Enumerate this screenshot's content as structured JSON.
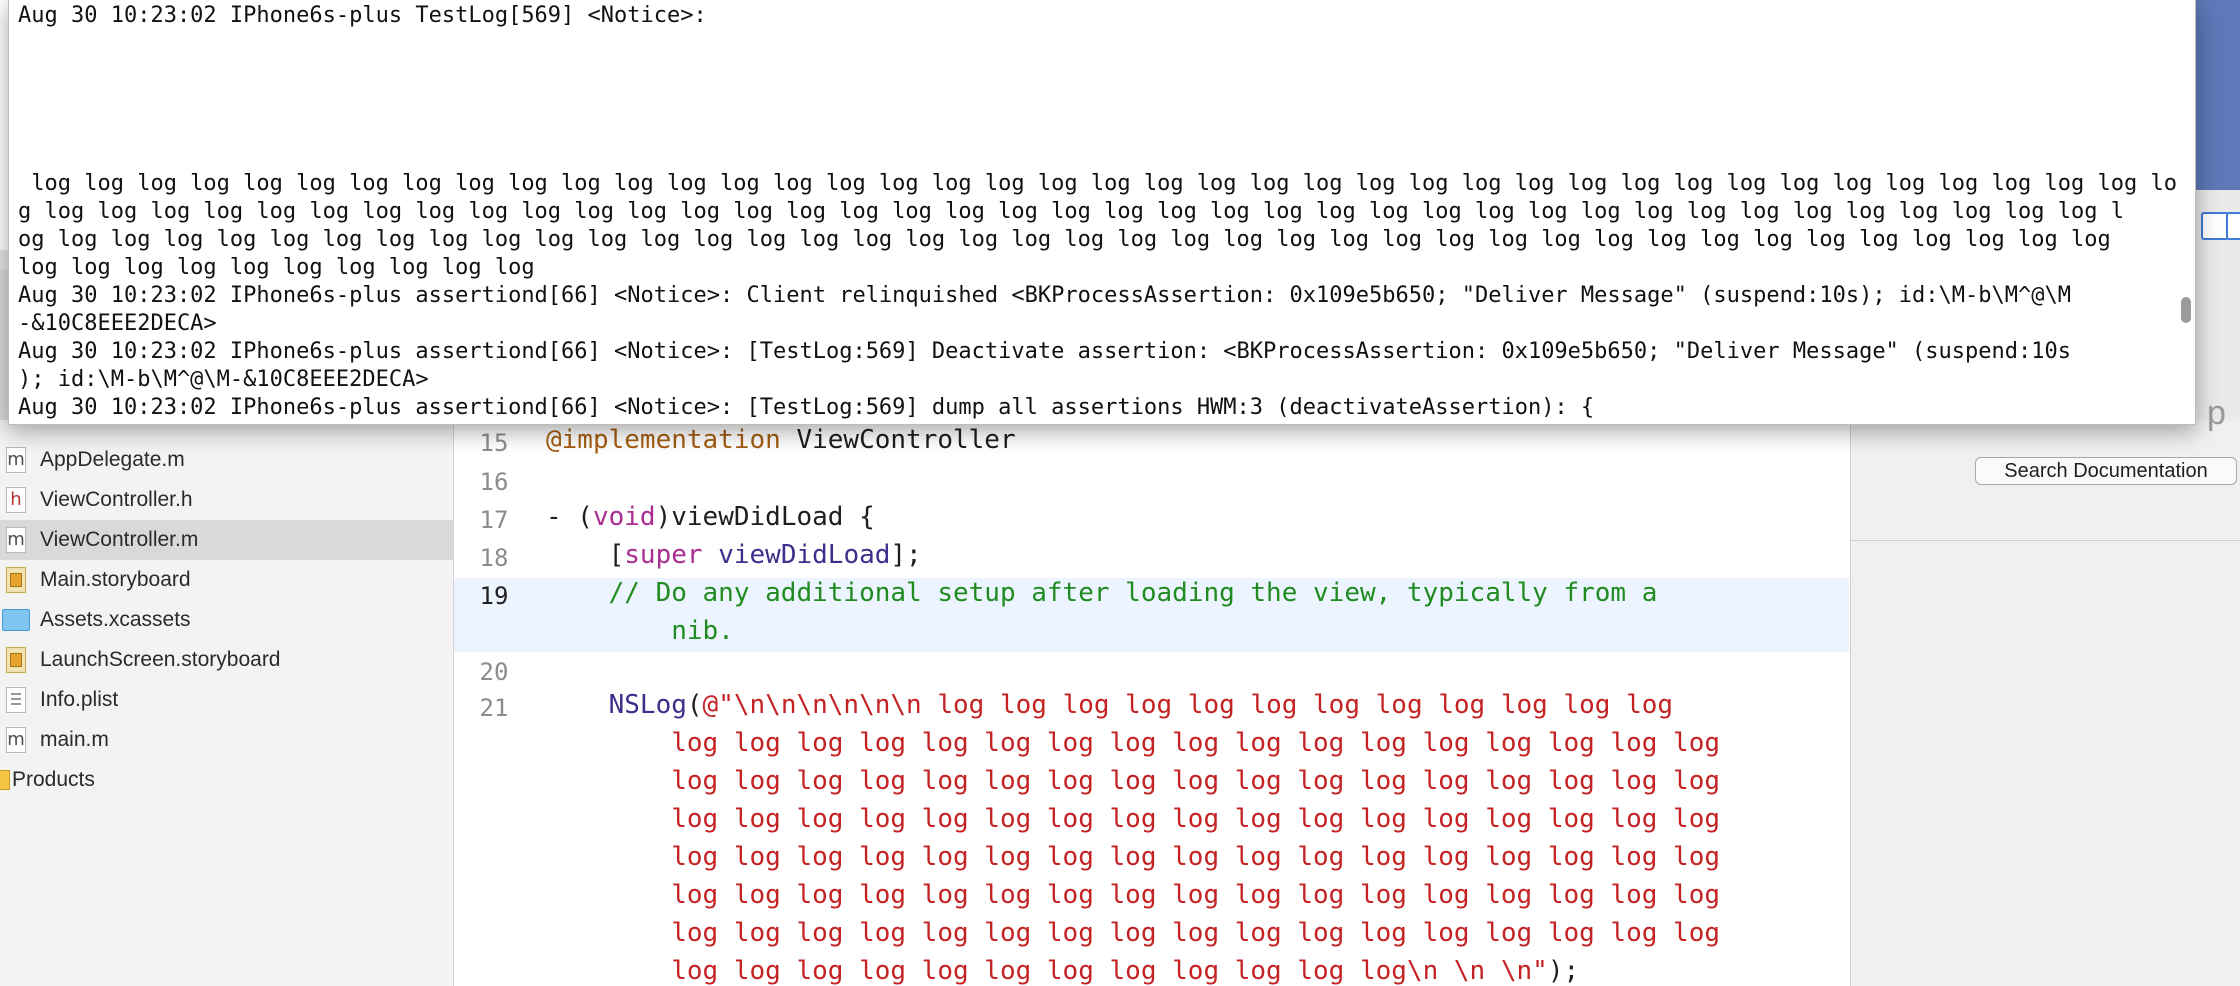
{
  "console": {
    "lines": [
      "Aug 30 10:23:02 IPhone6s-plus TestLog[569] <Notice>:",
      " log log log log log log log log log log log log log log log log log log log log log log log log log log log log log log log log log log log log log log log log lo",
      "g log log log log log log log log log log log log log log log log log log log log log log log log log log log log log log log log log log log log log log log l",
      "og log log log log log log log log log log log log log log log log log log log log log log log log log log log log log log log log log log log log log log log",
      "log log log log log log log log log log",
      "Aug 30 10:23:02 IPhone6s-plus assertiond[66] <Notice>: Client relinquished <BKProcessAssertion: 0x109e5b650; \"Deliver Message\" (suspend:10s); id:\\M-b\\M^@\\M",
      "-&10C8EEE2DECA>",
      "Aug 30 10:23:02 IPhone6s-plus assertiond[66] <Notice>: [TestLog:569] Deactivate assertion: <BKProcessAssertion: 0x109e5b650; \"Deliver Message\" (suspend:10s",
      "); id:\\M-b\\M^@\\M-&10C8EEE2DECA>",
      "Aug 30 10:23:02 IPhone6s-plus assertiond[66] <Notice>: [TestLog:569] dump all assertions HWM:3 (deactivateAssertion): {"
    ]
  },
  "navigator": {
    "items": [
      {
        "label": "AppDelegate.m",
        "icon": "m-file-icon"
      },
      {
        "label": "ViewController.h",
        "icon": "h-file-icon"
      },
      {
        "label": "ViewController.m",
        "icon": "m-file-icon",
        "selected": true
      },
      {
        "label": "Main.storyboard",
        "icon": "storyboard-icon"
      },
      {
        "label": "Assets.xcassets",
        "icon": "assets-folder-icon"
      },
      {
        "label": "LaunchScreen.storyboard",
        "icon": "storyboard-icon"
      },
      {
        "label": "Info.plist",
        "icon": "plist-icon"
      },
      {
        "label": "main.m",
        "icon": "m-file-icon"
      },
      {
        "label": "Products",
        "icon": "folder-icon"
      }
    ]
  },
  "editor": {
    "line_numbers": [
      "15",
      "16",
      "17",
      "18",
      "19",
      "20",
      "21"
    ],
    "current_line": "19",
    "code": {
      "l15_directive": "@implementation",
      "l15_name": " ViewController",
      "l17_prefix": "- (",
      "l17_kw": "void",
      "l17_rest": ")viewDidLoad {",
      "l18_open": "    [",
      "l18_kw": "super",
      "l18_method": " viewDidLoad",
      "l18_close": "];",
      "l19_comment": "    // Do any additional setup after loading the view, typically from a",
      "l19_comment_wrap": "        nib.",
      "l21_fn": "    NSLog",
      "l21_paren": "(",
      "l21_str": "@\"\\n\\n\\n\\n\\n\\n log log log log log log log log log log log log",
      "wrap1": "        log log log log log log log log log log log log log log log log log",
      "wrap2": "        log log log log log log log log log log log log log log log log log",
      "wrap3": "        log log log log log log log log log log log log log log log log log",
      "wrap4": "        log log log log log log log log log log log log log log log log log",
      "wrap5": "        log log log log log log log log log log log log log log log log log",
      "wrap6": "        log log log log log log log log log log log log log log log log log",
      "wrap7_str": "        log log log log log log log log log log log log\\n \\n \\n\"",
      "wrap7_end": ");"
    }
  },
  "inspector": {
    "search_button": "Search Documentation",
    "help_glyph": "p"
  }
}
